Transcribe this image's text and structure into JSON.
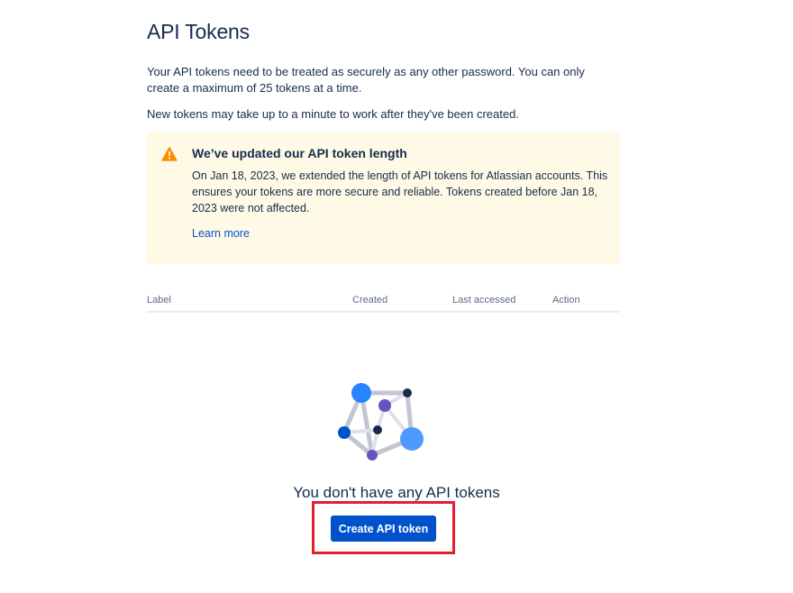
{
  "header": {
    "title": "API Tokens"
  },
  "intro": {
    "paragraph_1": "Your API tokens need to be treated as securely as any other password. You can only create a maximum of 25 tokens at a time.",
    "paragraph_2": "New tokens may take up to a minute to work after they've been created."
  },
  "notice": {
    "icon": "warning-icon",
    "title": "We’ve updated our API token length",
    "body": "On Jan 18, 2023, we extended the length of API tokens for Atlassian accounts. This ensures your tokens are more secure and reliable. Tokens created before Jan 18, 2023 were not affected.",
    "link_label": "Learn more"
  },
  "table": {
    "columns": [
      "Label",
      "Created",
      "Last accessed",
      "Action"
    ],
    "rows": []
  },
  "empty_state": {
    "illustration": "token-network-illustration",
    "title": "You don't have any API tokens",
    "button_label": "Create API token"
  },
  "colors": {
    "primary": "#0052cc",
    "text": "#172b4d",
    "subtle_text": "#5e6c84",
    "notice_bg": "#fffae6",
    "warning": "#ff8b00",
    "highlight": "#e02030"
  }
}
